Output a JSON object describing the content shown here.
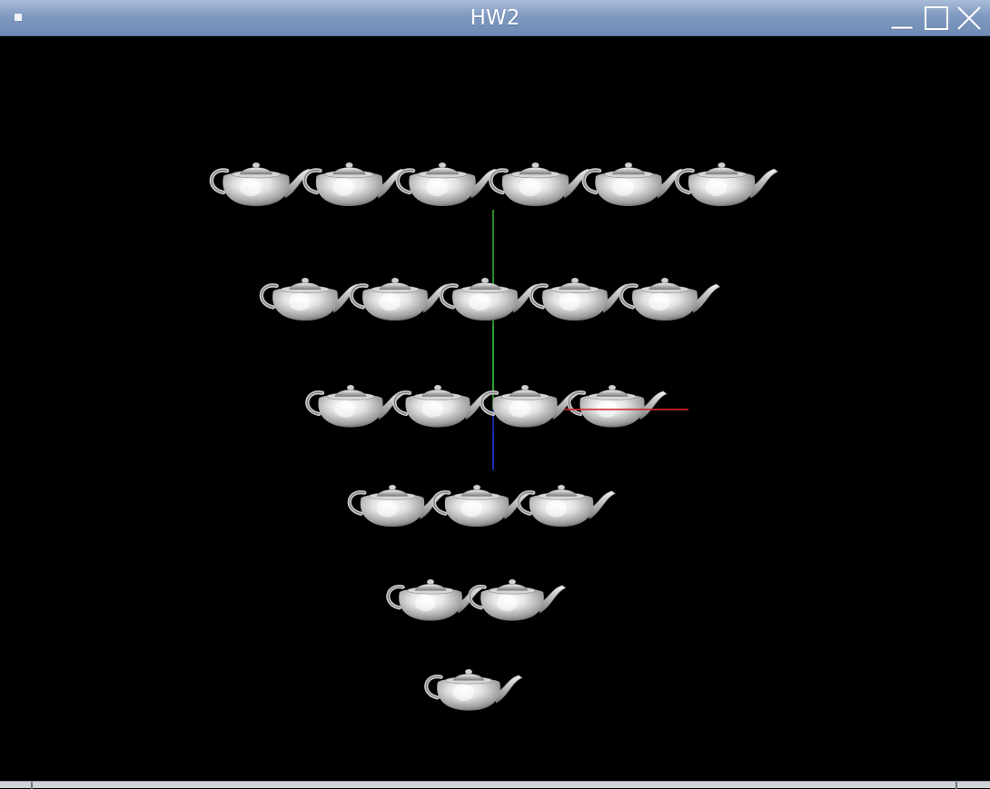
{
  "window": {
    "title": "HW2",
    "controls": [
      "minimize",
      "maximize",
      "close"
    ],
    "icons": {
      "menu": "window-menu-icon",
      "minimize": "minimize-icon",
      "maximize": "maximize-icon",
      "close": "close-icon"
    }
  },
  "scene": {
    "background_color": "#000000",
    "object": "teapot",
    "rows": [
      6,
      5,
      4,
      3,
      2,
      1
    ],
    "axes": {
      "x_color": "#cc2222",
      "y_color": "#33bb33",
      "z_color": "#2233cc"
    }
  }
}
